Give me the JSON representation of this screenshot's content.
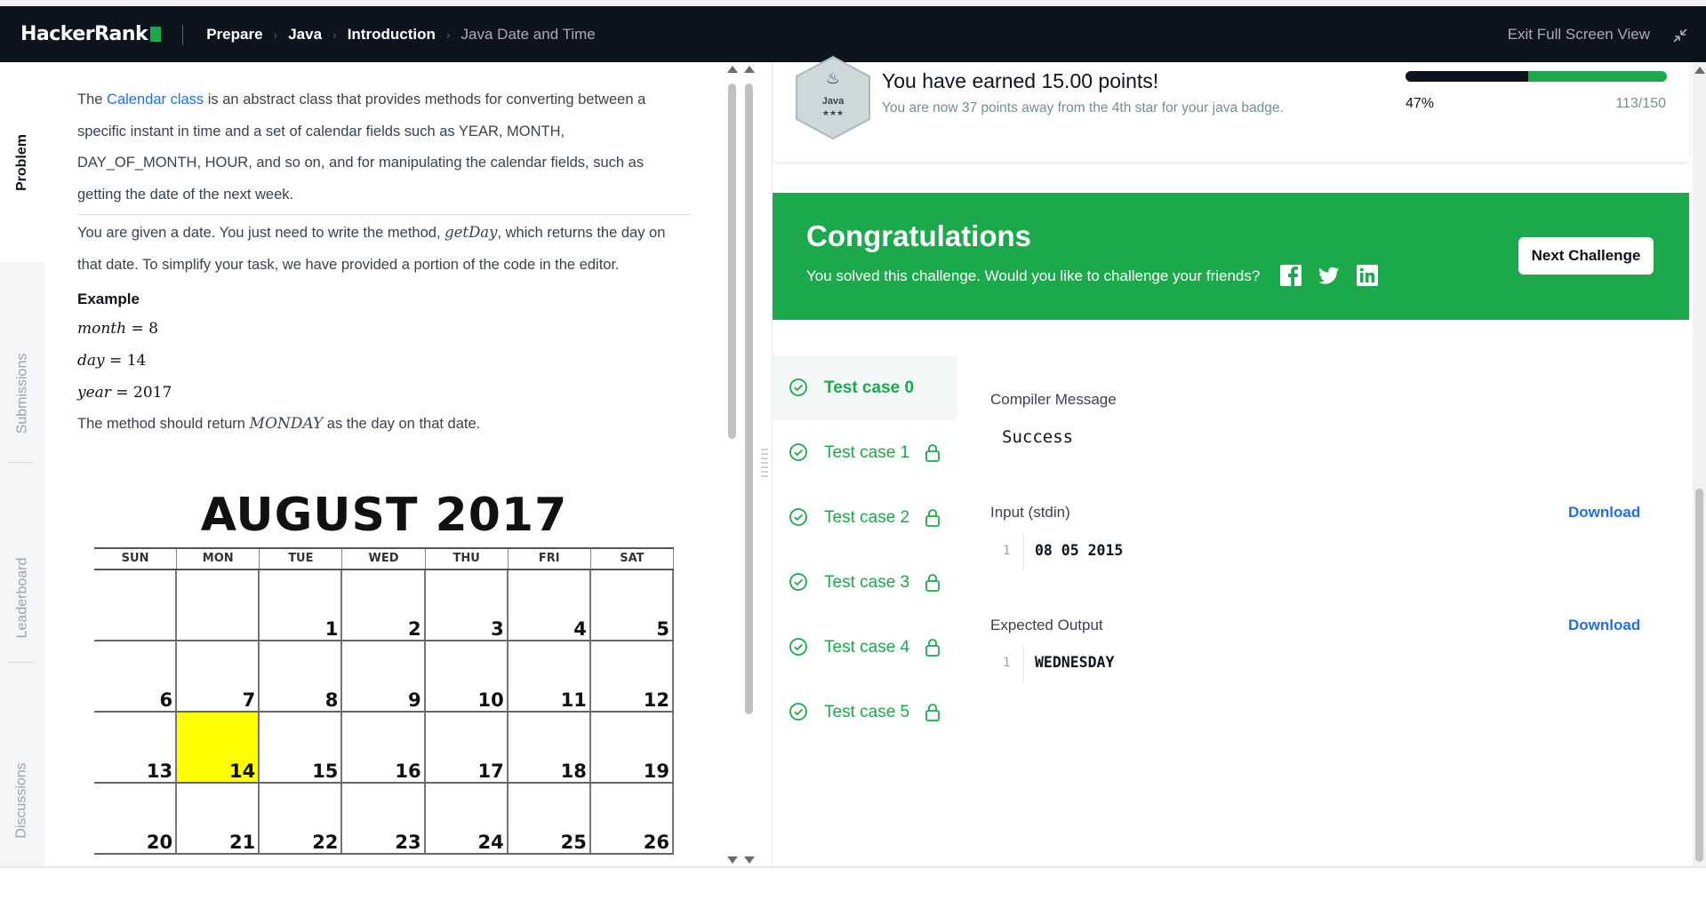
{
  "header": {
    "logo_text": "HackerRank",
    "breadcrumbs": [
      "Prepare",
      "Java",
      "Introduction"
    ],
    "current": "Java Date and Time",
    "exit_label": "Exit Full Screen View"
  },
  "tabs": [
    "Problem",
    "Submissions",
    "Leaderboard",
    "Discussions"
  ],
  "problem": {
    "para1_link": "Calendar class",
    "para1_rest_a": " is an abstract class that provides methods for converting between a specific instant in time and a set of calendar fields such as YEAR, MONTH, DAY_OF_MONTH, HOUR, and so on, and for manipulating the calendar fields, such as getting the date of the next week.",
    "para1_prefix": "The ",
    "para2_a": "You are given a date. You just need to write the method, ",
    "para2_method": "getDay",
    "para2_b": ", which returns the day on that date. To simplify your task, we have provided a portion of the code in the editor.",
    "example_title": "Example",
    "month_var": "month",
    "month_val": "8",
    "day_var": "day",
    "day_val": "14",
    "year_var": "year",
    "year_val": "2017",
    "return_a": "The method should return ",
    "return_val": "MONDAY",
    "return_b": " as the day on that date.",
    "equals": " = "
  },
  "calendar": {
    "title": "AUGUST  2017",
    "days": [
      "SUN",
      "MON",
      "TUE",
      "WED",
      "THU",
      "FRI",
      "SAT"
    ],
    "weeks": [
      [
        "",
        "",
        "1",
        "2",
        "3",
        "4",
        "5"
      ],
      [
        "6",
        "7",
        "8",
        "9",
        "10",
        "11",
        "12"
      ],
      [
        "13",
        "14",
        "15",
        "16",
        "17",
        "18",
        "19"
      ],
      [
        "20",
        "21",
        "22",
        "23",
        "24",
        "25",
        "26"
      ]
    ],
    "highlight": "14",
    "highlight_color": "#ffff00"
  },
  "points": {
    "badge_label": "Java",
    "badge_stars": "★★★",
    "title": "You have earned 15.00 points!",
    "subtitle": "You are now 37 points away from the 4th star for your java badge.",
    "progress_percent": "47%",
    "progress_value": 0.47,
    "progress_fraction": "113/150"
  },
  "congrats": {
    "title": "Congratulations",
    "subtitle": "You solved this challenge. Would you like to challenge your friends?",
    "next_button": "Next Challenge"
  },
  "test_cases": [
    {
      "label": "Test case 0",
      "locked": false
    },
    {
      "label": "Test case 1",
      "locked": true
    },
    {
      "label": "Test case 2",
      "locked": true
    },
    {
      "label": "Test case 3",
      "locked": true
    },
    {
      "label": "Test case 4",
      "locked": true
    },
    {
      "label": "Test case 5",
      "locked": true
    }
  ],
  "result": {
    "compiler_label": "Compiler Message",
    "compiler_message": "Success",
    "input_label": "Input (stdin)",
    "input_line_no": "1",
    "input_value": "08 05 2015",
    "output_label": "Expected Output",
    "output_line_no": "1",
    "output_value": "WEDNESDAY",
    "download_label": "Download"
  },
  "colors": {
    "brand_green": "#1ba94c",
    "header_bg": "#0e141e",
    "link_blue": "#1f6feb"
  },
  "icons": [
    "logo-mark",
    "exit-fullscreen-icon",
    "java-badge-icon",
    "facebook-icon",
    "twitter-icon",
    "linkedin-icon",
    "check-circle-icon",
    "lock-icon"
  ]
}
